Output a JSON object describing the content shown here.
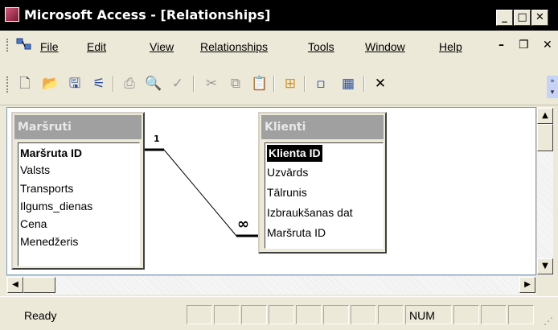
{
  "window": {
    "title": "Microsoft Access - [Relationships]",
    "controls": {
      "minimize": "_",
      "maximize": "□",
      "close": "✕"
    }
  },
  "menu": {
    "items": [
      {
        "label": "File"
      },
      {
        "label": "Edit"
      },
      {
        "label": "View"
      },
      {
        "label": "Relationships"
      },
      {
        "label": "Tools"
      },
      {
        "label": "Window"
      },
      {
        "label": "Help"
      }
    ],
    "mdi_controls": {
      "minimize": "–",
      "restore": "❐",
      "close": "✕"
    }
  },
  "toolbar": {
    "icons": [
      "new-icon",
      "open-icon",
      "save-icon",
      "relationships-icon",
      "print-icon",
      "print-preview-icon",
      "spelling-icon",
      "cut-icon",
      "copy-icon",
      "paste-icon",
      "show-table-icon",
      "show-direct-icon",
      "show-all-icon",
      "delete-icon"
    ],
    "glyphs": {
      "new": "🗋",
      "open": "📂",
      "save": "🖫",
      "relationships": "⚟",
      "print": "⎙",
      "preview": "🔍",
      "spelling": "✓",
      "cut": "✂",
      "copy": "⧉",
      "paste": "📋",
      "show_table": "⊞",
      "show_direct": "▫",
      "show_all": "▦",
      "delete": "✕"
    }
  },
  "tables": [
    {
      "name": "Maršruti",
      "fields": [
        {
          "name": "Maršruta ID",
          "key": true
        },
        {
          "name": "Valsts"
        },
        {
          "name": "Transports"
        },
        {
          "name": "Ilgums_dienas"
        },
        {
          "name": "Cena"
        },
        {
          "name": "Menedžeris"
        }
      ]
    },
    {
      "name": "Klienti",
      "fields": [
        {
          "name": "Klienta ID",
          "key": true,
          "selected": true
        },
        {
          "name": "Uzvārds"
        },
        {
          "name": "Tālrunis"
        },
        {
          "name": "Izbraukšanas dat"
        },
        {
          "name": "Maršruta ID"
        }
      ]
    }
  ],
  "relationship": {
    "one_label": "1",
    "many_label": "∞"
  },
  "scrollbars": {
    "up": "▲",
    "down": "▼",
    "left": "◀",
    "right": "▶"
  },
  "status": {
    "text": "Ready",
    "num": "NUM"
  },
  "colors": {
    "titlebar": "#000000",
    "selected_field": "#000000",
    "table_title": "#a0a0a0"
  }
}
